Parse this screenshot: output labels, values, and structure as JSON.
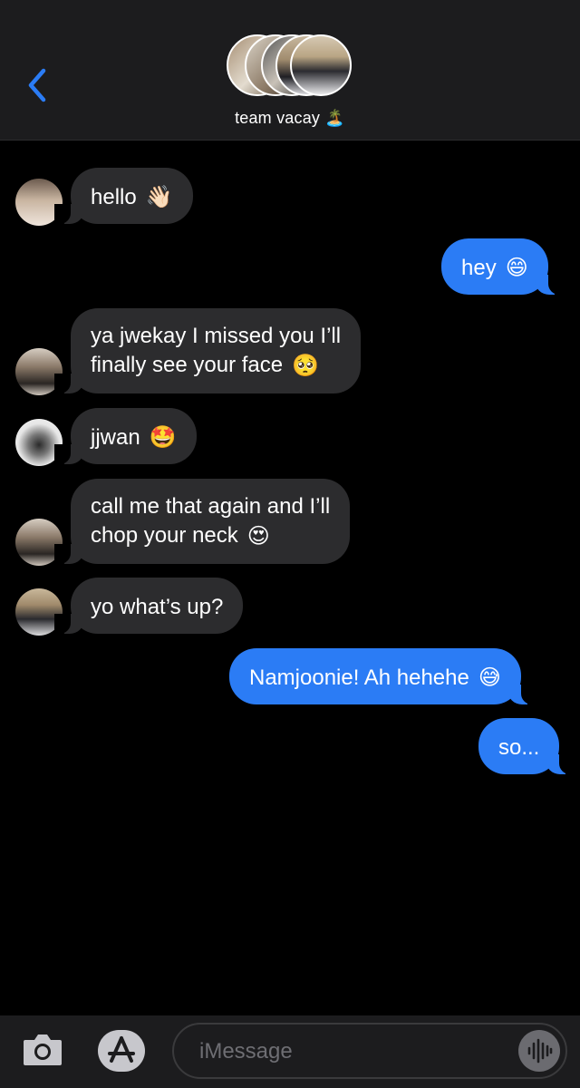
{
  "header": {
    "group_name": "team vacay",
    "group_emoji": "🏝️",
    "back_icon": "chevron-left-icon"
  },
  "messages": [
    {
      "side": "in",
      "text": "hello",
      "emoji": "👋🏻"
    },
    {
      "side": "out",
      "text": "hey",
      "emoji": "😄"
    },
    {
      "side": "in",
      "line1": "ya jwekay I missed you I’ll",
      "line2": "finally see your face",
      "emoji": "🥺"
    },
    {
      "side": "in",
      "text": "jjwan",
      "emoji": "🤩"
    },
    {
      "side": "in",
      "line1": "call me that again and I’ll",
      "line2": "chop your neck",
      "emoji": "😍"
    },
    {
      "side": "in",
      "text": "yo what’s up?"
    },
    {
      "side": "out",
      "text": "Namjoonie! Ah hehehe",
      "emoji": "😅"
    },
    {
      "side": "out",
      "text": "so..."
    }
  ],
  "composer": {
    "placeholder": "iMessage",
    "camera_icon": "camera-icon",
    "apps_icon": "app-store-icon",
    "audio_icon": "audio-waveform-icon"
  },
  "colors": {
    "accent": "#2b7cf5",
    "incoming_bubble": "#2c2c2e",
    "background": "#000000",
    "bars": "#1c1c1e"
  }
}
